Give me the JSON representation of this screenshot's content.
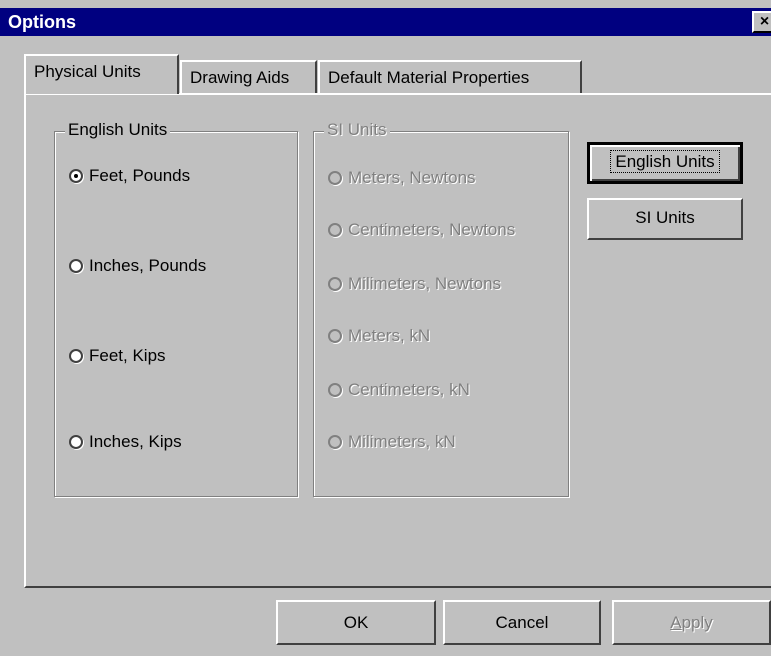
{
  "window": {
    "title": "Options",
    "close_label": "×"
  },
  "tabs": [
    {
      "label": "Physical Units",
      "active": true
    },
    {
      "label": "Drawing Aids",
      "active": false
    },
    {
      "label": "Default Material Properties",
      "active": false
    }
  ],
  "english_group": {
    "legend": "English Units",
    "options": [
      {
        "label": "Feet, Pounds",
        "checked": true
      },
      {
        "label": "Inches, Pounds",
        "checked": false
      },
      {
        "label": "Feet, Kips",
        "checked": false
      },
      {
        "label": "Inches, Kips",
        "checked": false
      }
    ]
  },
  "si_group": {
    "legend": "SI Units",
    "disabled": true,
    "options": [
      {
        "label": "Meters, Newtons",
        "checked": false
      },
      {
        "label": "Centimeters, Newtons",
        "checked": false
      },
      {
        "label": "Milimeters, Newtons",
        "checked": false
      },
      {
        "label": "Meters, kN",
        "checked": false
      },
      {
        "label": "Centimeters, kN",
        "checked": false
      },
      {
        "label": "Milimeters, kN",
        "checked": false
      }
    ]
  },
  "side_buttons": {
    "english_label": "English Units",
    "si_label": "SI Units"
  },
  "footer": {
    "ok_label": "OK",
    "cancel_label": "Cancel",
    "apply_accel": "A",
    "apply_rest": "pply"
  },
  "colors": {
    "titlebar": "#000080",
    "face": "#c0c0c0",
    "disabled_text": "#808080"
  }
}
